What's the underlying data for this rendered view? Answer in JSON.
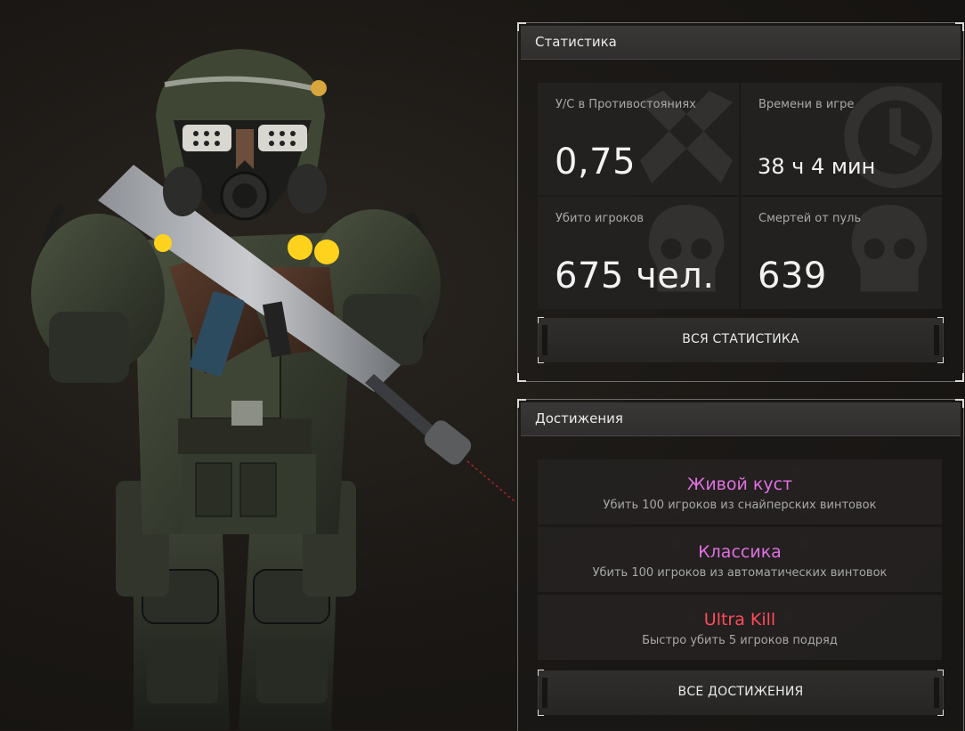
{
  "colors": {
    "accent_purple": "#e070e0",
    "accent_red": "#ff4b5a",
    "panel_border": "#6e6e6e"
  },
  "stats_panel": {
    "title": "Статистика",
    "tiles": [
      {
        "label": "У/С в Противостояниях",
        "value": "0,75",
        "icon": "crossed-swords-icon"
      },
      {
        "label": "Времени в игре",
        "value": "38 ч 4 мин",
        "icon": "clock-icon"
      },
      {
        "label": "Убито игроков",
        "value": "675 чел.",
        "icon": "skull-icon"
      },
      {
        "label": "Смертей от пуль",
        "value": "639",
        "icon": "skull-icon"
      }
    ],
    "button_label": "ВСЯ СТАТИСТИКА"
  },
  "achievements_panel": {
    "title": "Достижения",
    "items": [
      {
        "title": "Живой куст",
        "description": "Убить 100 игроков из снайперских винтовок",
        "color": "#e070e0"
      },
      {
        "title": "Классика",
        "description": "Убить 100 игроков из автоматических винтовок",
        "color": "#e070e0"
      },
      {
        "title": "Ultra Kill",
        "description": "Быстро убить 5 игроков подряд",
        "color": "#ff4b5a"
      }
    ],
    "button_label": "ВСЕ ДОСТИЖЕНИЯ"
  }
}
